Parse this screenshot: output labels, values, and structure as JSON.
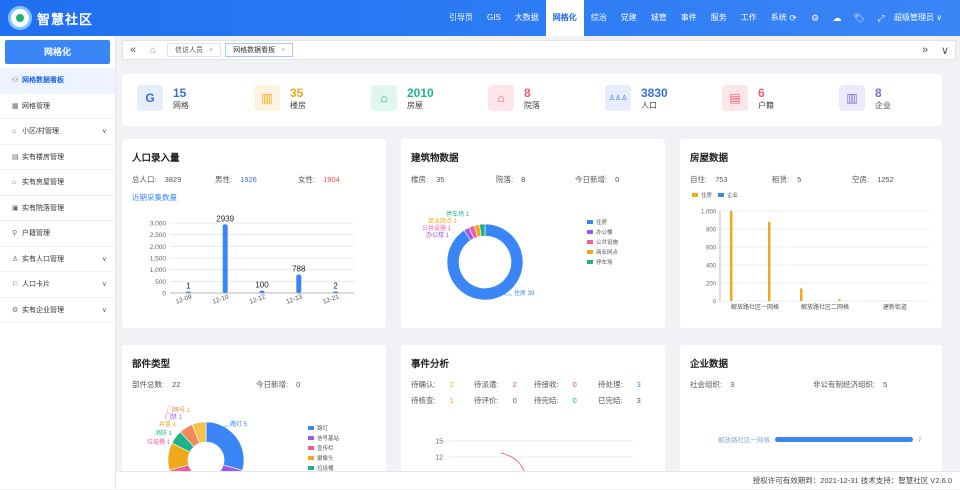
{
  "app": {
    "title": "智慧社区"
  },
  "nav": [
    "引导页",
    "GIS",
    "大数据",
    "网格化",
    "综治",
    "党建",
    "城管",
    "事件",
    "服务",
    "工作",
    "系统"
  ],
  "nav_active_index": 3,
  "tools": [
    "⟳",
    "⚙",
    "☁",
    "🏷",
    "⤢"
  ],
  "user": {
    "name": "超级管理员 ∨"
  },
  "sidebar": {
    "title": "网格化",
    "items": [
      {
        "label": "网格数据看板",
        "icon": "⚇",
        "chev": ""
      },
      {
        "label": "网格管理",
        "icon": "▦",
        "chev": ""
      },
      {
        "label": "小区/村管理",
        "icon": "⌂",
        "chev": "∨"
      },
      {
        "label": "实有楼房管理",
        "icon": "▤",
        "chev": ""
      },
      {
        "label": "实有房屋管理",
        "icon": "⌂",
        "chev": ""
      },
      {
        "label": "实有院落管理",
        "icon": "▣",
        "chev": ""
      },
      {
        "label": "户籍管理",
        "icon": "⚲",
        "chev": ""
      },
      {
        "label": "实有人口管理",
        "icon": "♙",
        "chev": "∨"
      },
      {
        "label": "人口卡片",
        "icon": "⚐",
        "chev": "∨"
      },
      {
        "label": "实有企业管理",
        "icon": "⚙",
        "chev": "∨"
      }
    ]
  },
  "tabs": {
    "prev": "«",
    "next": "»",
    "more": "∨",
    "home": "⌂",
    "items": [
      {
        "label": "信访人员",
        "close": "×"
      },
      {
        "label": "网格数据看板",
        "close": "×"
      }
    ]
  },
  "stats": [
    {
      "value": "15",
      "label": "网格",
      "icon": "G",
      "color": "#3a6fd8",
      "bg": "#e6eefc"
    },
    {
      "value": "35",
      "label": "楼房",
      "icon": "▥",
      "color": "#f0a81c",
      "bg": "#fdf3e0"
    },
    {
      "value": "2010",
      "label": "房屋",
      "icon": "⌂",
      "color": "#1bb28c",
      "bg": "#e0f6f0"
    },
    {
      "value": "8",
      "label": "院落",
      "icon": "⌂",
      "color": "#ef5b73",
      "bg": "#fde6ea"
    },
    {
      "value": "3830",
      "label": "人口",
      "icon": "♙♙♙",
      "color": "#3a6fd8",
      "bg": "#e6eefc"
    },
    {
      "value": "6",
      "label": "户籍",
      "icon": "▤",
      "color": "#ef5b73",
      "bg": "#fde6ea"
    },
    {
      "value": "8",
      "label": "企业",
      "icon": "▥",
      "color": "#7a6cd8",
      "bg": "#ecebfb"
    }
  ],
  "population": {
    "title": "人口录入量",
    "total_label": "总人口:",
    "total": "3829",
    "male_label": "男性:",
    "male": "1926",
    "female_label": "女性:",
    "female": "1904",
    "link": "近期采集数量"
  },
  "building": {
    "title": "建筑物数据",
    "floors_label": "楼房:",
    "floors": "35",
    "yards_label": "院落:",
    "yards": "8",
    "today_label": "今日新增:",
    "today": "0"
  },
  "house": {
    "title": "房屋数据",
    "self_label": "自住:",
    "self": "753",
    "rent_label": "租赁:",
    "rent": "5",
    "empty_label": "空房:",
    "empty": "1252"
  },
  "parts": {
    "title": "部件类型",
    "total_label": "部件总数:",
    "total": "22",
    "today_label": "今日新增:",
    "today": "0"
  },
  "events": {
    "title": "事件分析",
    "rows": [
      [
        {
          "label": "待确认:",
          "value": "2",
          "color": "#f0a81c"
        },
        {
          "label": "待派遣:",
          "value": "2",
          "color": "#ef4b5a"
        },
        {
          "label": "待接收:",
          "value": "0",
          "color": "#ef4b5a"
        },
        {
          "label": "待处理:",
          "value": "3",
          "color": "#3a86f7"
        }
      ],
      [
        {
          "label": "待核查:",
          "value": "1",
          "color": "#f0a81c"
        },
        {
          "label": "待评价:",
          "value": "0",
          "color": "#555"
        },
        {
          "label": "待完结:",
          "value": "0",
          "color": "#1bb28c"
        },
        {
          "label": "已完结:",
          "value": "3",
          "color": "#555"
        }
      ]
    ]
  },
  "enterprise": {
    "title": "企业数据",
    "org_label": "社会组织:",
    "org": "3",
    "np_label": "非公有制经济组织:",
    "np": "5"
  },
  "footer": {
    "text": "授权许可有效期到：2021-12-31 技术支持：智慧社区  V2.6.0"
  },
  "colors": {
    "primary": "#3a86f7",
    "bar": "#3a86f7"
  },
  "chart_data": [
    {
      "type": "bar",
      "categories": [
        "12-09",
        "12-10",
        "12-12",
        "12-13",
        "12-21"
      ],
      "values": [
        1,
        2939,
        100,
        788,
        2
      ],
      "ylim": [
        0,
        3000
      ],
      "yticks": [
        "0",
        "500",
        "1,000",
        "1,500",
        "2,000",
        "2,500",
        "3,000"
      ],
      "data_labels": [
        "1",
        "2939",
        "100",
        "788",
        "2"
      ],
      "grid": true
    },
    {
      "type": "pie",
      "labels": [
        "住房",
        "办公楼",
        "公共设施",
        "商业网点",
        "停车场"
      ],
      "values": [
        39,
        1,
        1,
        1,
        1
      ],
      "callouts": [
        "住房 39",
        "办公楼 1",
        "公共设施 1",
        "商业网点 1",
        "停车场 1"
      ],
      "colors": [
        "#3a86f7",
        "#9b59f0",
        "#ef5b9c",
        "#f0a81c",
        "#1bb28c"
      ],
      "legend": "right"
    },
    {
      "type": "bar",
      "categories": [
        "解放路社区一网格",
        "解放路社区二网格",
        "建新街道"
      ],
      "series": [
        {
          "name": "住房",
          "values": [
            1000,
            140,
            2
          ],
          "color": "#f0a81c"
        },
        {
          "name": "企业",
          "values": [
            0,
            0,
            0
          ],
          "color": "#3a86f7"
        }
      ],
      "extra_bars": [
        880,
        20
      ],
      "ylim": [
        0,
        1000
      ],
      "yticks": [
        "0",
        "200",
        "400",
        "600",
        "800",
        "1,000"
      ],
      "legend": "top-left"
    },
    {
      "type": "pie",
      "labels": [
        "路灯",
        "信号基站",
        "宣传栏",
        "摄像头",
        "垃圾桶"
      ],
      "values": [
        5,
        4,
        3,
        2,
        2
      ],
      "callouts": [
        "路灯 5",
        "门牌号 1",
        "门禁 1",
        "井盖 1",
        "消防 1",
        "垃圾桶 1"
      ],
      "colors": [
        "#3a86f7",
        "#9b59f0",
        "#ef5b9c",
        "#f0a81c",
        "#1bb28c",
        "#f08a5b"
      ],
      "legend": "right"
    },
    {
      "type": "line",
      "yticks": [
        "12",
        "15"
      ]
    },
    {
      "type": "bar",
      "categories": [
        "解放路社区一网格"
      ],
      "values": [
        7
      ],
      "data_labels": [
        "7"
      ]
    }
  ]
}
